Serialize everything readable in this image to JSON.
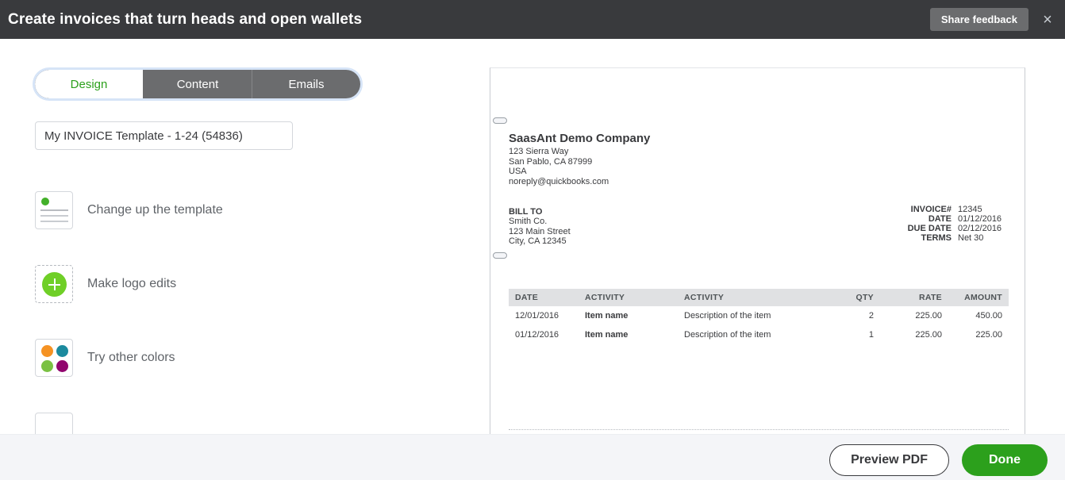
{
  "header": {
    "title": "Create invoices that turn heads and open wallets",
    "share_feedback_label": "Share feedback",
    "close_glyph": "×"
  },
  "tabs": [
    {
      "label": "Design",
      "active": true
    },
    {
      "label": "Content",
      "active": false
    },
    {
      "label": "Emails",
      "active": false
    }
  ],
  "template_name": {
    "value": "My INVOICE Template - 1-24 (54836)",
    "placeholder": "Template name"
  },
  "design_options": [
    {
      "label": "Change up the template",
      "icon": "document-icon"
    },
    {
      "label": "Make logo edits",
      "icon": "plus-circle-icon"
    },
    {
      "label": "Try other colors",
      "icon": "color-swatch-icon"
    }
  ],
  "palette": {
    "orange": "#f59223",
    "teal": "#1b8a9e",
    "green": "#7ac143",
    "magenta": "#91056e",
    "brand_green": "#2ca01c",
    "header_bg": "#393a3d"
  },
  "invoice": {
    "company": {
      "name": "SaasAnt Demo Company",
      "address_line1": "123 Sierra Way",
      "address_line2": "San Pablo, CA 87999",
      "country": "USA",
      "email": "noreply@quickbooks.com"
    },
    "bill_to": {
      "label": "BILL TO",
      "name": "Smith Co.",
      "street": "123 Main Street",
      "citystate": "City, CA 12345"
    },
    "meta": {
      "invoice_number_label": "INVOICE#",
      "invoice_number_value": "12345",
      "date_label": "DATE",
      "date_value": "01/12/2016",
      "due_date_label": "DUE DATE",
      "due_date_value": "02/12/2016",
      "terms_label": "TERMS",
      "terms_value": "Net 30"
    },
    "table": {
      "columns": [
        "DATE",
        "ACTIVITY",
        "ACTIVITY",
        "QTY",
        "RATE",
        "AMOUNT"
      ],
      "rows": [
        {
          "date": "12/01/2016",
          "activity": "Item name",
          "description": "Description of the item",
          "qty": "2",
          "rate": "225.00",
          "amount": "450.00"
        },
        {
          "date": "01/12/2016",
          "activity": "Item name",
          "description": "Description of the item",
          "qty": "1",
          "rate": "225.00",
          "amount": "225.00"
        }
      ]
    }
  },
  "footer": {
    "preview_label": "Preview PDF",
    "done_label": "Done"
  }
}
